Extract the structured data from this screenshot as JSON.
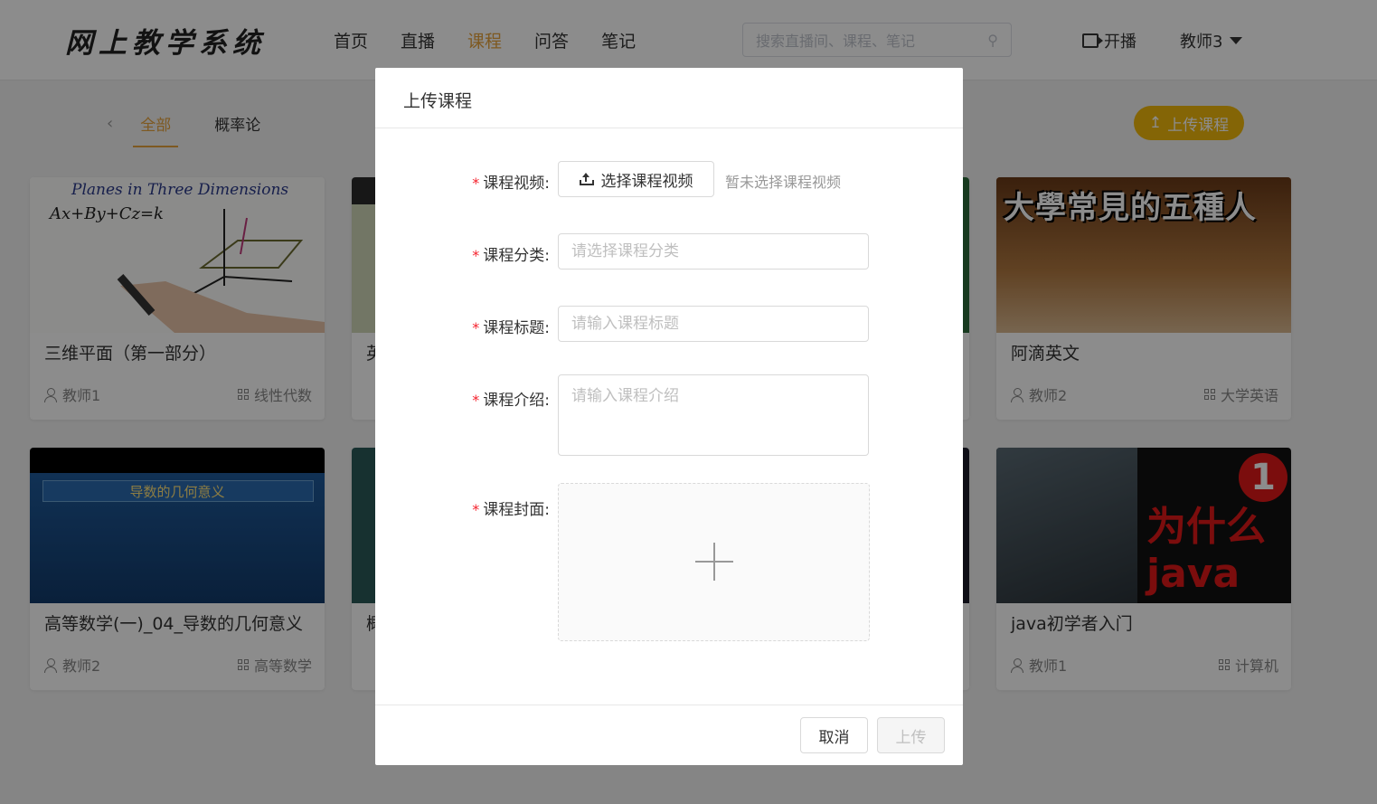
{
  "header": {
    "logo": "网上教学系统",
    "nav": [
      "首页",
      "直播",
      "课程",
      "问答",
      "笔记"
    ],
    "nav_active_index": 2,
    "search_placeholder": "搜索直播间、课程、笔记",
    "broadcast_label": "开播",
    "user_name": "教师3"
  },
  "categories": {
    "items": [
      "全部",
      "概率论"
    ],
    "active_index": 0
  },
  "upload_button_label": "上传课程",
  "courses": [
    {
      "title": "三维平面（第一部分）",
      "teacher": "教师1",
      "category": "线性代数",
      "thumb_text": "Planes in Three Dimensions"
    },
    {
      "title": "英",
      "teacher": "",
      "category": "",
      "thumb_text": ""
    },
    {
      "title": "阿滴英文",
      "teacher": "教师2",
      "category": "大学英语",
      "thumb_text": "大學常見的五種人"
    },
    {
      "title": "高等数学(一)_04_导数的几何意义",
      "teacher": "教师2",
      "category": "高等数学",
      "thumb_text": "导数的几何意义"
    },
    {
      "title": "概",
      "teacher": "",
      "category": "",
      "thumb_text": ""
    },
    {
      "title": "java初学者入门",
      "teacher": "教师1",
      "category": "计算机",
      "thumb_text": "为什么java"
    }
  ],
  "modal": {
    "title": "上传课程",
    "fields": {
      "video_label": "课程视频:",
      "video_button": "选择课程视频",
      "video_hint": "暂未选择课程视频",
      "category_label": "课程分类:",
      "category_placeholder": "请选择课程分类",
      "title_label": "课程标题:",
      "title_placeholder": "请输入课程标题",
      "intro_label": "课程介绍:",
      "intro_placeholder": "请输入课程介绍",
      "cover_label": "课程封面:"
    },
    "cancel_label": "取消",
    "submit_label": "上传"
  },
  "colors": {
    "accent": "#e6a23c",
    "upload_button_bg": "#f0b90b",
    "required": "#f5222d"
  }
}
